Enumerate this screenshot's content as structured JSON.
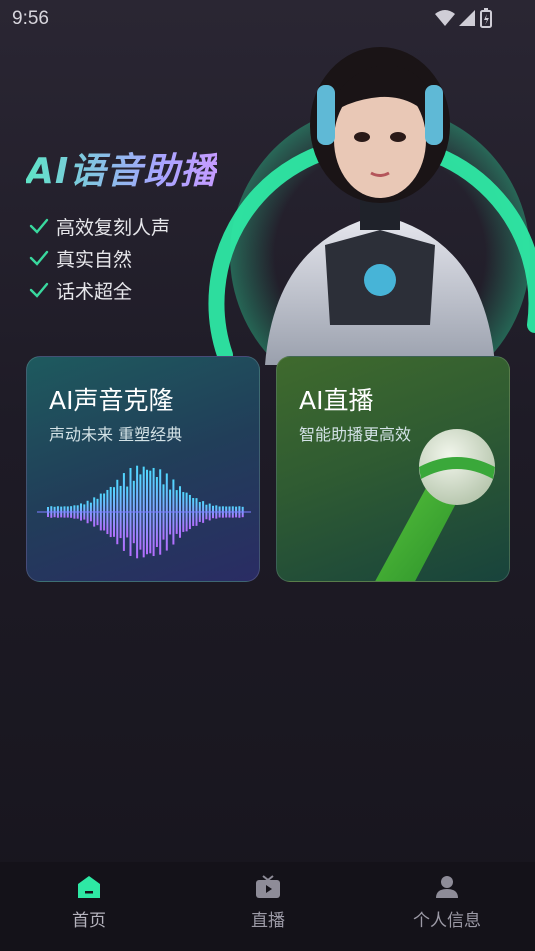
{
  "status_bar": {
    "time": "9:56",
    "icons": [
      "wifi-icon",
      "signal-icon",
      "battery-icon"
    ]
  },
  "hero": {
    "title": "AI语音助播",
    "features": [
      "高效复刻人声",
      "真实自然",
      "话术超全"
    ],
    "check_color": "#39d89e"
  },
  "cards": [
    {
      "title": "AI声音克隆",
      "subtitle": "声动未来 重塑经典"
    },
    {
      "title": "AI直播",
      "subtitle": "智能助播更高效"
    }
  ],
  "bottom_nav": [
    {
      "label": "首页",
      "icon": "home-icon",
      "active": true
    },
    {
      "label": "直播",
      "icon": "tv-icon",
      "active": false
    },
    {
      "label": "个人信息",
      "icon": "user-icon",
      "active": false
    }
  ],
  "colors": {
    "accent": "#2ee8a4",
    "background": "#1e1b26",
    "nav_bg": "#141219"
  }
}
